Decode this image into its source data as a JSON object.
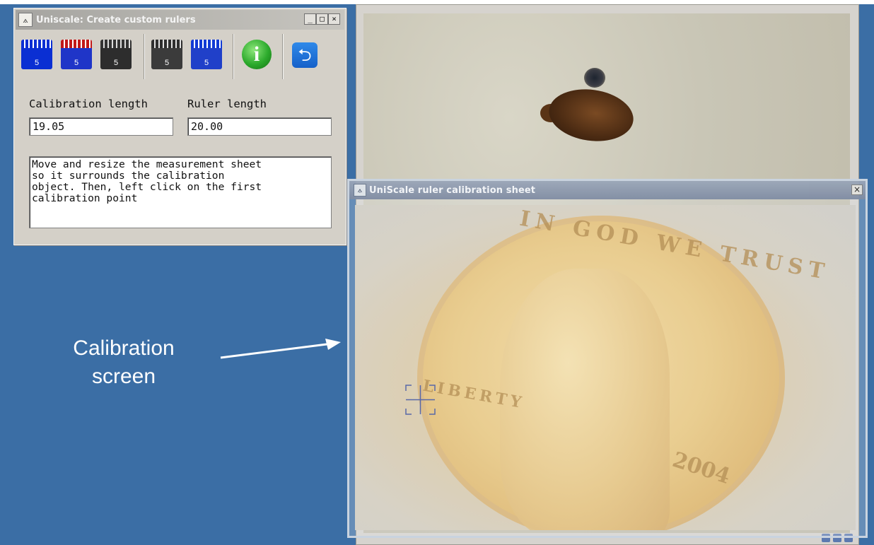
{
  "tool_window": {
    "title": "Uniscale: Create custom rulers",
    "controls": {
      "minimize": "_",
      "maximize": "□",
      "close": "×"
    },
    "toolbar": {
      "buttons": [
        {
          "name": "ruler-button",
          "number": "5"
        },
        {
          "name": "undo-ruler-button",
          "number": "5"
        },
        {
          "name": "delete-ruler-button",
          "number": "5"
        },
        {
          "name": "next-ruler-button",
          "number": "5"
        },
        {
          "name": "previous-ruler-button",
          "number": "5"
        }
      ],
      "info_glyph": "i",
      "back_glyph": "⮌"
    },
    "calibration_length_label": "Calibration length",
    "calibration_length_value": "19.05",
    "ruler_length_label": "Ruler length",
    "ruler_length_value": "20.00",
    "instructions": "Move and resize the measurement sheet\nso it surrounds the calibration\nobject. Then, left click on the first\ncalibration point"
  },
  "calibration_sheet": {
    "title": "UniScale ruler calibration sheet",
    "close": "×"
  },
  "coin": {
    "motto": "IN GOD WE TRUST",
    "liberty": "LIBERTY",
    "year": "2004"
  },
  "annotation": {
    "line1": "Calibration",
    "line2": "screen"
  },
  "colors": {
    "desktop": "#3b6ea5",
    "window_face": "#d4d0c8",
    "annotation_text": "#ffffff"
  }
}
